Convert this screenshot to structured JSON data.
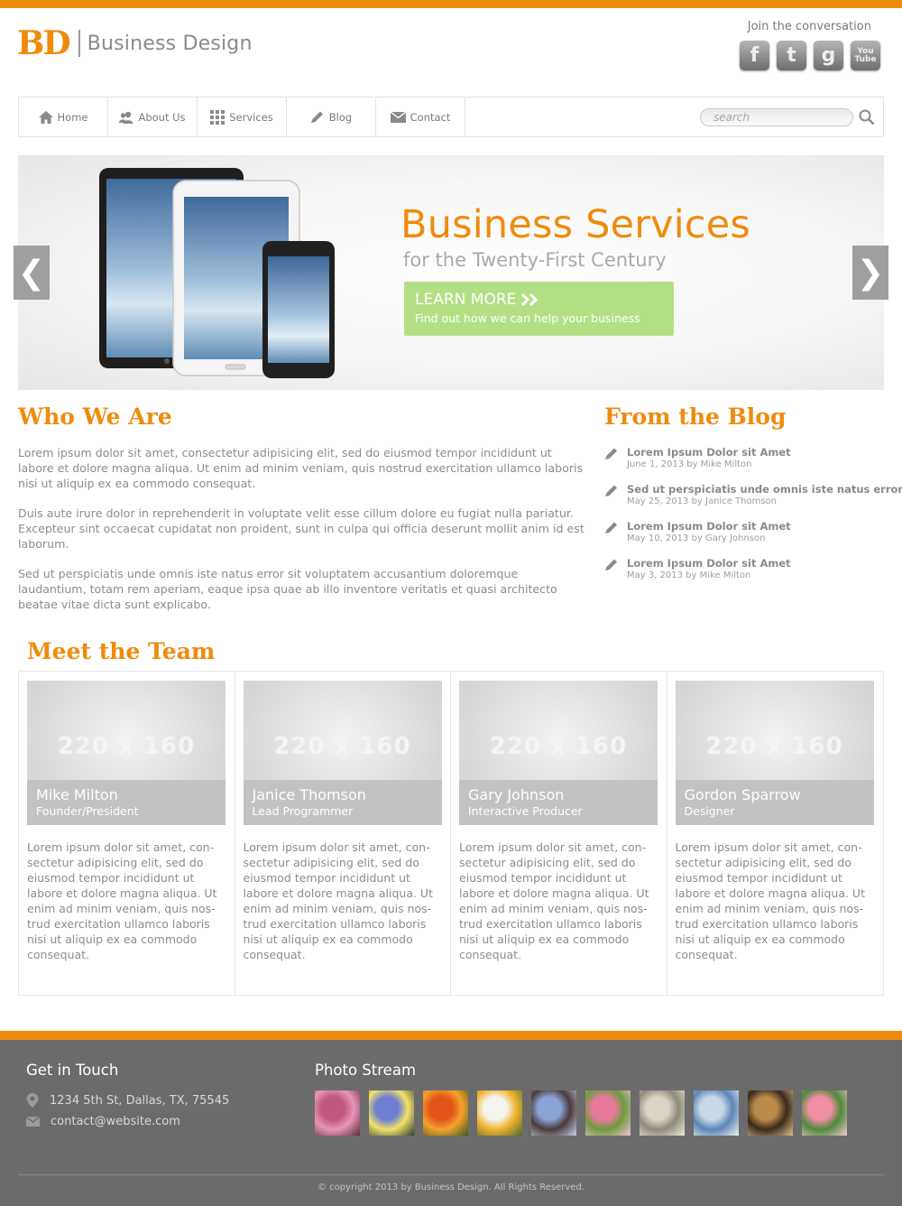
{
  "brand": {
    "mark": "BD",
    "name": "Business Design",
    "accent_color": "#ef8b0c"
  },
  "social": {
    "label": "Join the conversation",
    "icons": [
      "facebook-icon",
      "twitter-icon",
      "google-icon",
      "youtube-icon"
    ],
    "glyphs": {
      "facebook": "f",
      "twitter": "t",
      "google": "g",
      "youtube_top": "You",
      "youtube_bottom": "Tube"
    }
  },
  "nav": {
    "items": [
      {
        "label": "Home",
        "icon": "home-icon"
      },
      {
        "label": "About Us",
        "icon": "users-icon"
      },
      {
        "label": "Services",
        "icon": "grid-icon"
      },
      {
        "label": "Blog",
        "icon": "pencil-icon"
      },
      {
        "label": "Contact",
        "icon": "mail-icon"
      }
    ],
    "search_placeholder": "search"
  },
  "hero": {
    "title": "Business Services",
    "subtitle": "for the Twenty-First Century",
    "cta_title": "LEARN MORE",
    "cta_text": "Find out how we can help your business",
    "prev_glyph": "❮",
    "next_glyph": "❯",
    "cta_color": "#b3df84"
  },
  "who": {
    "heading": "Who We Are",
    "paragraphs": [
      "Lorem ipsum dolor sit amet, consectetur adipisicing elit, sed do eiusmod tempor incididunt ut labore et dolore magna aliqua. Ut enim ad minim veniam, quis nostrud exercitation ullamco laboris nisi ut aliquip ex ea commodo consequat.",
      "Duis aute irure dolor in reprehenderit in voluptate velit esse cillum dolore eu fugiat nulla pariatur. Excepteur sint occaecat cupidatat non proident, sunt in culpa qui officia deserunt mollit anim id est laborum.",
      "Sed ut perspiciatis unde omnis iste natus error sit voluptatem accusantium doloremque laudantium, totam rem aperiam, eaque ipsa quae ab illo inventore veritatis et quasi architecto beatae vitae dicta sunt explicabo."
    ]
  },
  "blog": {
    "heading": "From the Blog",
    "posts": [
      {
        "title": "Lorem Ipsum Dolor sit Amet",
        "meta": "June 1, 2013 by Mike Milton"
      },
      {
        "title": "Sed ut perspiciatis unde omnis iste natus error",
        "meta": "May 25, 2013 by Janice Thomson"
      },
      {
        "title": "Lorem Ipsum Dolor sit Amet",
        "meta": "May 10, 2013 by Gary Johnson"
      },
      {
        "title": "Lorem Ipsum Dolor sit Amet",
        "meta": "May 3, 2013 by Mike Milton"
      }
    ]
  },
  "team": {
    "heading": "Meet the Team",
    "placeholder": "220 x 160",
    "members": [
      {
        "name": "Mike Milton",
        "role": "Founder/President",
        "bio": "Lorem ipsum dolor sit amet, con-sectetur adipisicing elit, sed do eiusmod tempor incididunt ut labore et dolore magna aliqua. Ut enim ad minim veniam, quis nos-trud exercitation ullamco laboris nisi ut aliquip ex ea commodo consequat."
      },
      {
        "name": "Janice Thomson",
        "role": "Lead Programmer",
        "bio": "Lorem ipsum dolor sit amet, con-sectetur adipisicing elit, sed do eiusmod tempor incididunt ut labore et dolore magna aliqua. Ut enim ad minim veniam, quis nos-trud exercitation ullamco laboris nisi ut aliquip ex ea commodo consequat."
      },
      {
        "name": "Gary Johnson",
        "role": "Interactive Producer",
        "bio": "Lorem ipsum dolor sit amet, con-sectetur adipisicing elit, sed do eiusmod tempor incididunt ut labore et dolore magna aliqua. Ut enim ad minim veniam, quis nos-trud exercitation ullamco laboris nisi ut aliquip ex ea commodo consequat."
      },
      {
        "name": "Gordon Sparrow",
        "role": "Designer",
        "bio": "Lorem ipsum dolor sit amet, con-sectetur adipisicing elit, sed do eiusmod tempor incididunt ut labore et dolore magna aliqua. Ut enim ad minim veniam, quis nos-trud exercitation ullamco laboris nisi ut aliquip ex ea commodo consequat."
      }
    ]
  },
  "footer": {
    "contact_heading": "Get in Touch",
    "address": "1234 5th St, Dallas, TX, 75545",
    "email": "contact@website.com",
    "photos_heading": "Photo Stream",
    "photos": [
      {
        "name": "pink-blossom-photo",
        "colors": [
          "#c0577f",
          "#e995b7",
          "#5a2a3e"
        ]
      },
      {
        "name": "iris-photo",
        "colors": [
          "#6e7fd1",
          "#f1e26a",
          "#2a3d2f"
        ]
      },
      {
        "name": "tulips-orange-photo",
        "colors": [
          "#e2541a",
          "#f6a12d",
          "#3b5a1d"
        ]
      },
      {
        "name": "daffodil-photo",
        "colors": [
          "#f4f4ee",
          "#f0b42f",
          "#4a6a2c"
        ]
      },
      {
        "name": "branches-sky-photo",
        "colors": [
          "#8aa4d6",
          "#4b3a3a",
          "#c9d3ea"
        ]
      },
      {
        "name": "tulips-pink-photo",
        "colors": [
          "#e77a9a",
          "#6e9a3f",
          "#f2c3cf"
        ]
      },
      {
        "name": "statue-photo",
        "colors": [
          "#d9d4c5",
          "#8f8a7a",
          "#efeadc"
        ]
      },
      {
        "name": "figurine-photo",
        "colors": [
          "#c8d8e6",
          "#5a86b7",
          "#f3f1ee"
        ]
      },
      {
        "name": "cheetah-photo",
        "colors": [
          "#b98a4a",
          "#3a2a1a",
          "#e0c18b"
        ]
      },
      {
        "name": "flamingo-photo",
        "colors": [
          "#f08ea4",
          "#4f8a3b",
          "#f6c7cf"
        ]
      }
    ],
    "copyright": "© copyright 2013 by Business Design. All Rights Reserved."
  }
}
